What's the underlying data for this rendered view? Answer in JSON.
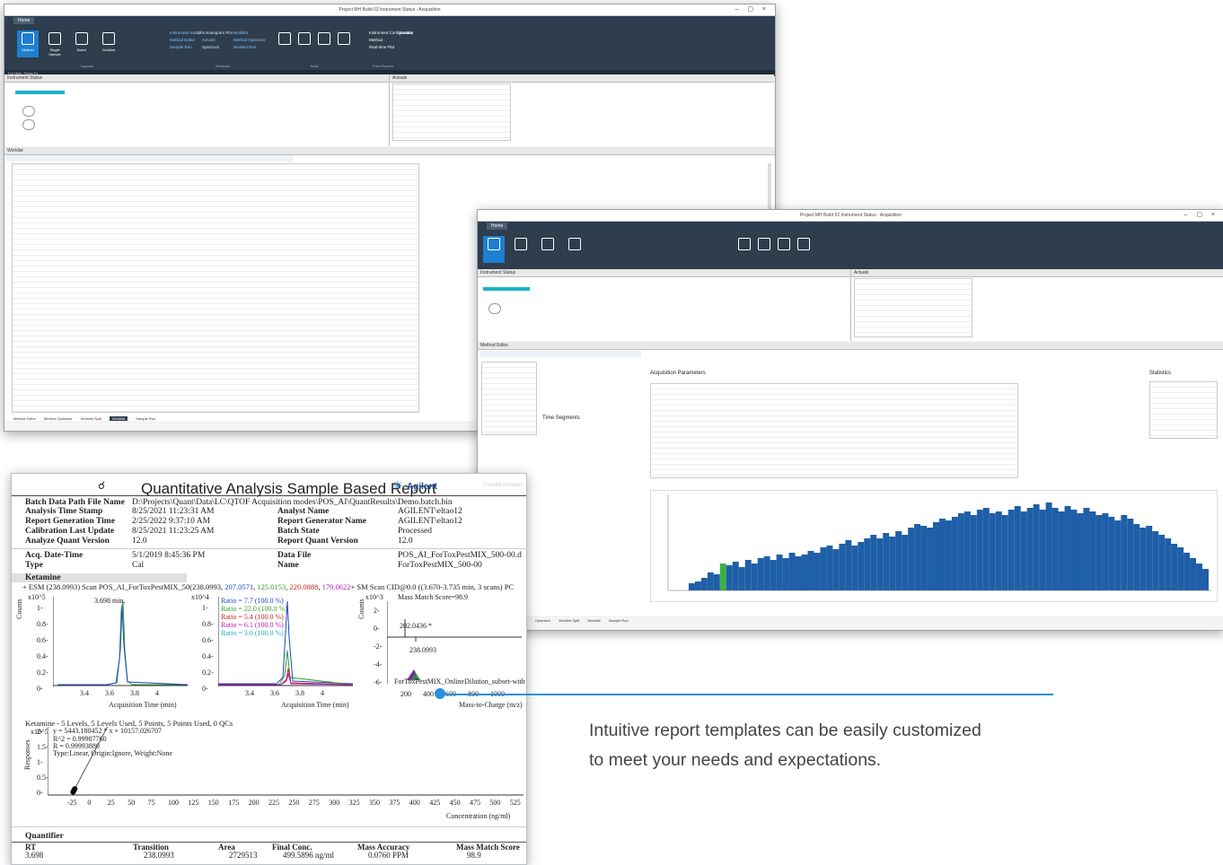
{
  "win1": {
    "title": "Project MH Build 02 Instrument Status - Acquisition",
    "tab": "Home",
    "buttons": [
      "Method",
      "Single Sample",
      "Batch",
      "Worklist"
    ],
    "ribbon_links": [
      "Instrument Status",
      "Chromatogram Plot",
      "Worklist",
      "Method Editor",
      "Actuals",
      "Method Optimizer",
      "Sample Run",
      "Spectrum",
      "Worklist Run"
    ],
    "tools": [
      "Analytical Column Setup",
      "Device Config",
      "System Activity Log",
      "Audit Trail Viewer"
    ],
    "groups": [
      "Layouts",
      "Windows",
      "Tools",
      "Print Reports"
    ],
    "instrument_cfg": [
      "Instrument Configuration",
      "Monitor",
      "Method",
      "Real-time Plot"
    ],
    "status_left": "For Help, Press F1",
    "instrument_status": "Instrument Status",
    "actuals": "Actuals",
    "worklist": "Worklist",
    "bottom_tabs": [
      "Method Editor",
      "Method Optimizer",
      "Worklist Split",
      "Worklist",
      "Sample Run"
    ]
  },
  "win2": {
    "title": "Project MH Build 02 Instrument Status - Acquisition",
    "tab": "Home",
    "instrument_status": "Instrument Status",
    "actuals": "Actuals",
    "method_editor": "Method Editor",
    "acq_params": "Acquisition Parameters",
    "time_segments": "Time Segments",
    "statistics": "Statistics",
    "bottom_tabs": [
      "Optimizer",
      "Worklist Split",
      "Worklist",
      "Sample Run"
    ]
  },
  "report": {
    "title": "Quantitative Analysis Sample Based Report",
    "logo": "Agilent",
    "logo_fade": "Trusted Answers",
    "rows": [
      {
        "k": "Batch Data Path File Name",
        "v": "D:\\Projects\\Quant\\Data\\LC\\QTOF Acquisition modes\\POS_AI\\QuantResults\\Demo.batch.bin"
      },
      {
        "k": "Analysis Time Stamp",
        "v": "8/25/2021 11:23:31 AM",
        "k2": "Analyst Name",
        "v2": "AGILENT\\eltao12"
      },
      {
        "k": "Report Generation Time",
        "v": "2/25/2022 9:37:10 AM",
        "k2": "Report Generator Name",
        "v2": "AGILENT\\eltao12"
      },
      {
        "k": "Calibration Last Update",
        "v": "8/25/2021 11:23:25 AM",
        "k2": "Batch State",
        "v2": "Processed"
      },
      {
        "k": "Analyze Quant Version",
        "v": "12.0",
        "k2": "Report Quant Version",
        "v2": "12.0"
      }
    ],
    "acq_label": "Acq. Date-Time",
    "acq_value": "5/1/2019 8:45:36 PM",
    "type_label": "Type",
    "type_value": "Cal",
    "datafile_label": "Data File",
    "datafile_value": "POS_AI_ForToxPestMIX_500-00.d",
    "name_label": "Name",
    "name_value": "ForToxPestMIX_500-00",
    "compound": "Ketamine",
    "scan_line_a": "+ ESM (238.0993) Scan POS_AI_ForToxPestMIX_50(",
    "scan_line_b": "238.0993, ",
    "scan_ions": [
      "207.0571",
      "125.0153",
      "220.0888",
      "179.0622"
    ],
    "scan_line_c": "+ SM Scan  CID@0.0 ((3.670-3.735 min, 3 scans) PC",
    "chrom1_peak": "3.698 min.",
    "ratios": [
      {
        "t": "Ratio = 7.7 (100.0 %)",
        "c": "#1f45c8"
      },
      {
        "t": "Ratio = 22.0 (100.0 %)",
        "c": "#2e9e2e"
      },
      {
        "t": "Ratio = 5.4 (100.0 %)",
        "c": "#c82020"
      },
      {
        "t": "Ratio = 6.1 (100.0 %)",
        "c": "#b01ab0"
      },
      {
        "t": "Ratio = 3.0 (100.0 %)",
        "c": "#1ab0c0"
      }
    ],
    "mass_match": "Mass Match Score=98.9",
    "spec_peak1": "202.0436 *",
    "spec_peak2": "238.0993",
    "spec_tag": "ForToxPestMIX_OnlineDilution_subset-with",
    "counts": "Counts",
    "x10_5": "x10^5",
    "x10_4": "x10^4",
    "x10_3": "x10^3",
    "acq_time_axis": "Acquisition Time (min)",
    "mz_axis": "Mass-to-Charge (m/z)",
    "chrom_y_ticks": [
      "1-",
      "0.8-",
      "0.6-",
      "0.4-",
      "0.2-",
      "0-"
    ],
    "chrom1_x_ticks": [
      "3.4",
      "3.6",
      "3.8",
      "4"
    ],
    "chrom2_x_ticks": [
      "3.4",
      "3.6",
      "3.8",
      "4"
    ],
    "spec_y_ticks": [
      "2-",
      "0-",
      "-2-",
      "-4-",
      "-6-"
    ],
    "spec_x_ticks": [
      "200",
      "400",
      "600",
      "800",
      "1000"
    ],
    "cal_title": "Ketamine - 5 Levels, 5 Levels Used, 5 Points, 5 Points Used, 0 QCs",
    "cal_eq": "y = 5443.180452 * x + 10157.026707",
    "cal_r2": "R^2 = 0.99987760",
    "cal_r": "R = 0.99993880",
    "cal_type": "Type:Linear, Origin:Ignore, Weight:None",
    "cal_y": "Responses",
    "cal_y_ticks": [
      "2-",
      "1.5-",
      "1-",
      "0.5-",
      "0-"
    ],
    "cal_x_ticks": [
      "-25",
      "0",
      "25",
      "50",
      "75",
      "100",
      "125",
      "150",
      "175",
      "200",
      "225",
      "250",
      "275",
      "300",
      "325",
      "350",
      "375",
      "400",
      "425",
      "450",
      "475",
      "500",
      "525"
    ],
    "cal_x_label": "Concentration (ng/ml)",
    "quantifier": "Quantifier",
    "q_headers": [
      "RT",
      "Transition",
      "Area",
      "Final Conc.",
      "Mass Accuracy",
      "Mass Match Score"
    ],
    "q_values": [
      "3.698",
      "238.0993",
      "2729513",
      "499.5896 ng/ml",
      "0.0760 PPM",
      "98.9"
    ]
  },
  "caption": {
    "line1": "Intuitive report templates can be easily customized",
    "line2": "to meet your needs and expectations."
  },
  "colors": {
    "ribbon": "#2f3d4c",
    "accent": "#1e7fd1",
    "callout": "#2a8fe0",
    "histogram": "#1f5fa8",
    "histogram_hl": "#3cb043"
  }
}
